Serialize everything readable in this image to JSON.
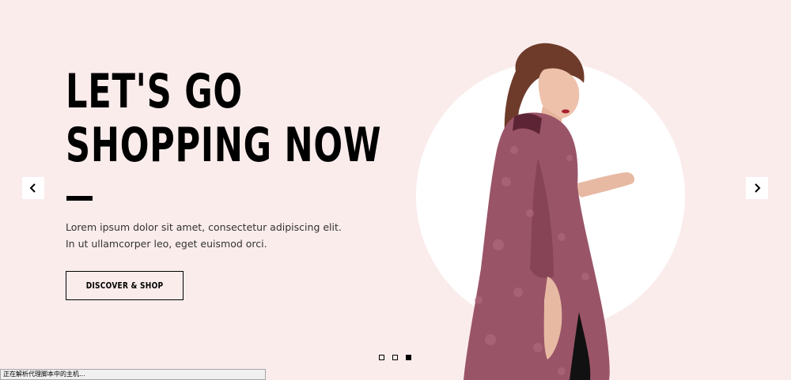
{
  "hero": {
    "headline_line1": "LET'S GO",
    "headline_line2": "SHOPPING NOW",
    "description": "Lorem ipsum dolor sit amet, consectetur adipiscing elit. In ut ullamcorper leo, eget euismod orci.",
    "cta_label": "DISCOVER & SHOP"
  },
  "slider": {
    "prev_icon": "chevron-left-icon",
    "next_icon": "chevron-right-icon",
    "active_slide": 3,
    "slide_count": 3
  },
  "status_bar": {
    "text": "正在解析代理脚本中的主机..."
  },
  "colors": {
    "background": "#fbecec",
    "circle": "#ffffff",
    "text": "#000000",
    "dress": "#9a5468"
  }
}
